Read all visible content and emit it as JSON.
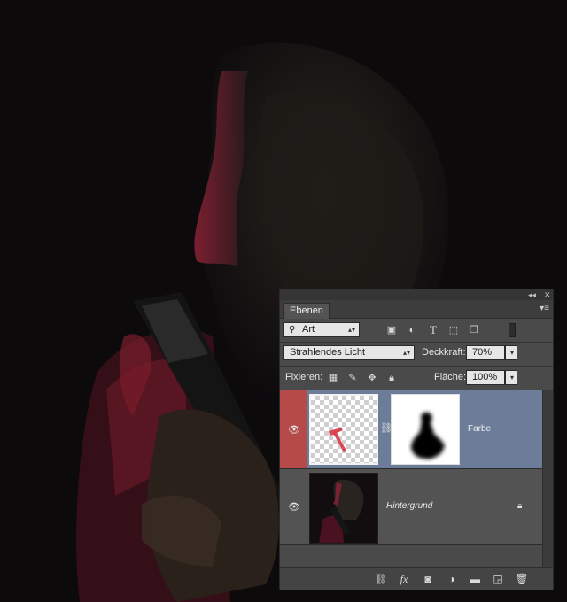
{
  "panel": {
    "collapse_icon": "double-chevron-icon",
    "close_icon": "close-icon",
    "tab_label": "Ebenen",
    "menu_icon": "panel-menu-icon",
    "filter": {
      "selected": "Art"
    },
    "filter_icons": [
      "image-filter-icon",
      "adjustment-filter-icon",
      "type-filter-icon",
      "shape-filter-icon",
      "smart-object-filter-icon"
    ],
    "blend_mode": "Strahlendes Licht",
    "opacity": {
      "label": "Deckkraft:",
      "value": "70%"
    },
    "lock": {
      "label": "Fixieren:",
      "icons": [
        "lock-transparent-icon",
        "lock-paint-icon",
        "lock-position-icon",
        "lock-all-icon"
      ]
    },
    "fill": {
      "label": "Fläche:",
      "value": "100%"
    },
    "layers": [
      {
        "name": "Farbe",
        "visible": true,
        "selected": true,
        "italic": false,
        "has_mask": true
      },
      {
        "name": "Hintergrund",
        "visible": true,
        "selected": false,
        "italic": true,
        "locked": true
      }
    ],
    "footer_icons": [
      "link-layers-icon",
      "fx-icon",
      "add-mask-icon",
      "adjustment-layer-icon",
      "new-group-icon",
      "new-layer-icon",
      "trash-icon"
    ],
    "footer_labels": {
      "fx": "fx"
    },
    "colors": {
      "panel_bg": "#4a4a4a",
      "selected_row": "#6b7d99",
      "eye_selected_bg": "#b64a48"
    }
  }
}
